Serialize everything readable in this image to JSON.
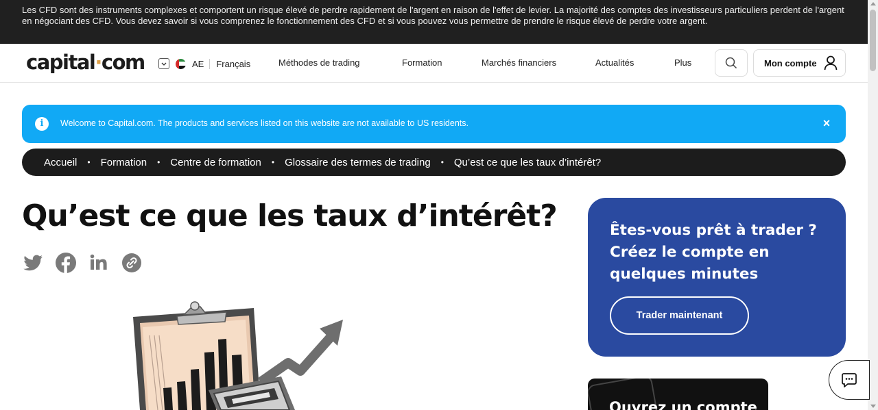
{
  "risk_banner": {
    "text": "Les CFD sont des instruments complexes et comportent un risque élevé de perdre rapidement de l'argent en raison de l'effet de levier. La majorité des comptes des investisseurs particuliers perdent de l'argent en négociant des CFD. Vous devez savoir si vous comprenez le fonctionnement des CFD et si vous pouvez vous permettre de prendre le risque élevé de perdre votre argent."
  },
  "header": {
    "logo_left": "capital",
    "logo_dot": "·",
    "logo_right": "com",
    "region_code": "AE",
    "language": "Français",
    "nav": [
      {
        "label": "Méthodes de trading"
      },
      {
        "label": "Formation"
      },
      {
        "label": "Marchés financiers"
      },
      {
        "label": "Actualités"
      },
      {
        "label": "Plus"
      }
    ],
    "account_label": "Mon compte"
  },
  "notice": {
    "text": "Welcome to Capital.com. The products and services listed on this website are not available to US residents.",
    "info_glyph": "i",
    "close_glyph": "×"
  },
  "breadcrumb": [
    {
      "label": "Accueil"
    },
    {
      "label": "Formation"
    },
    {
      "label": "Centre de formation"
    },
    {
      "label": "Glossaire des termes de trading"
    },
    {
      "label": "Qu’est ce que les taux d’intérêt?"
    }
  ],
  "breadcrumb_sep": "•",
  "page": {
    "title": "Qu’est ce que les taux d’intérêt?"
  },
  "share_icons": [
    "twitter-icon",
    "facebook-icon",
    "linkedin-icon",
    "copy-link-icon"
  ],
  "cta": {
    "heading": "Êtes-vous prêt à trader ? Créez le compte en quelques minutes",
    "button": "Trader maintenant"
  },
  "promo_card": {
    "text": "Ouvrez un compte"
  },
  "colors": {
    "risk_banner_bg": "#202020",
    "notice_bg": "#11a9f5",
    "breadcrumb_bg": "#1c1c1c",
    "cta_bg": "#2a4aa0",
    "logo_dot": "#e0a24a"
  }
}
